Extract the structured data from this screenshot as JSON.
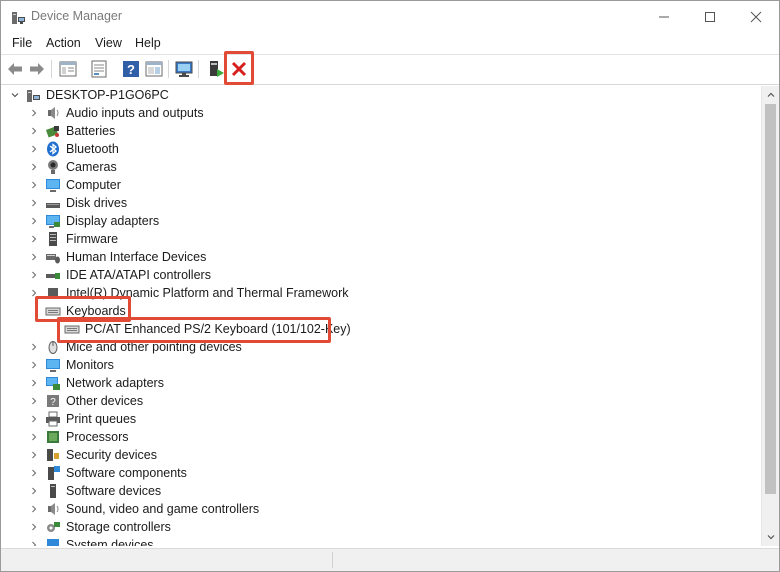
{
  "window": {
    "title": "Device Manager"
  },
  "menu": [
    "File",
    "Action",
    "View",
    "Help"
  ],
  "toolbar": {
    "buttons": [
      "back-arrow-icon",
      "forward-arrow-icon",
      "properties-icon",
      "update-driver-icon",
      "help-icon",
      "scan-list-icon",
      "monitor-icon",
      "enable-device-icon",
      "uninstall-device-icon"
    ],
    "highlight_color": "#e14b35"
  },
  "tree": {
    "root": "DESKTOP-P1GO6PC",
    "items": [
      {
        "label": "Audio inputs and outputs",
        "icon": "speaker-icon"
      },
      {
        "label": "Batteries",
        "icon": "battery-icon"
      },
      {
        "label": "Bluetooth",
        "icon": "bluetooth-icon"
      },
      {
        "label": "Cameras",
        "icon": "camera-icon"
      },
      {
        "label": "Computer",
        "icon": "computer-icon"
      },
      {
        "label": "Disk drives",
        "icon": "disk-drive-icon"
      },
      {
        "label": "Display adapters",
        "icon": "display-adapter-icon"
      },
      {
        "label": "Firmware",
        "icon": "firmware-icon"
      },
      {
        "label": "Human Interface Devices",
        "icon": "hid-icon"
      },
      {
        "label": "IDE ATA/ATAPI controllers",
        "icon": "ide-controller-icon"
      },
      {
        "label": "Intel(R) Dynamic Platform and Thermal Framework",
        "icon": "chip-icon"
      },
      {
        "label": "Keyboards",
        "icon": "keyboard-icon",
        "expanded": true
      },
      {
        "label": "PC/AT Enhanced PS/2 Keyboard (101/102-Key)",
        "icon": "keyboard-icon",
        "child": true
      },
      {
        "label": "Mice and other pointing devices",
        "icon": "mouse-icon"
      },
      {
        "label": "Monitors",
        "icon": "monitor-icon"
      },
      {
        "label": "Network adapters",
        "icon": "network-adapter-icon"
      },
      {
        "label": "Other devices",
        "icon": "other-devices-icon"
      },
      {
        "label": "Print queues",
        "icon": "printer-icon"
      },
      {
        "label": "Processors",
        "icon": "processor-icon"
      },
      {
        "label": "Security devices",
        "icon": "security-device-icon"
      },
      {
        "label": "Software components",
        "icon": "software-component-icon"
      },
      {
        "label": "Software devices",
        "icon": "software-device-icon"
      },
      {
        "label": "Sound, video and game controllers",
        "icon": "sound-icon"
      },
      {
        "label": "Storage controllers",
        "icon": "storage-controller-icon"
      },
      {
        "label": "System devices",
        "icon": "system-device-icon"
      }
    ]
  }
}
